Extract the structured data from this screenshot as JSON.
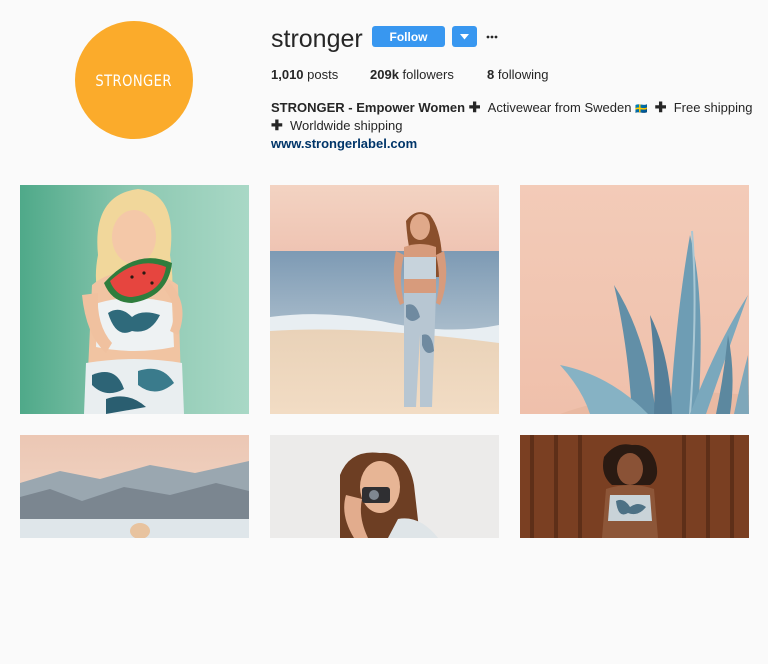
{
  "profile": {
    "avatar_text": "STRONGER",
    "username": "stronger",
    "follow_label": "Follow",
    "posts_count": "1,010",
    "posts_label": "posts",
    "followers_count": "209k",
    "followers_label": "followers",
    "following_count": "8",
    "following_label": "following",
    "bio_name": "STRONGER - Empower Women",
    "bio_part1": "Activewear from Sweden",
    "bio_flag": "🇸🇪",
    "bio_part2": "Free shipping",
    "bio_part3": "Worldwide shipping",
    "plus_symbol": "✚",
    "website": "www.strongerlabel.com"
  },
  "colors": {
    "accent": "#3897f0",
    "avatar_bg": "#fbab2b",
    "link": "#003569",
    "background": "#fafafa"
  },
  "icons": {
    "dropdown": "chevron-down-icon",
    "more": "ellipsis-icon"
  },
  "posts": [
    {
      "name": "woman-with-watermelon-post"
    },
    {
      "name": "woman-on-beach-post"
    },
    {
      "name": "agave-plant-post"
    },
    {
      "name": "mountain-landscape-post"
    },
    {
      "name": "woman-with-camera-post"
    },
    {
      "name": "woman-wood-wall-post"
    }
  ]
}
